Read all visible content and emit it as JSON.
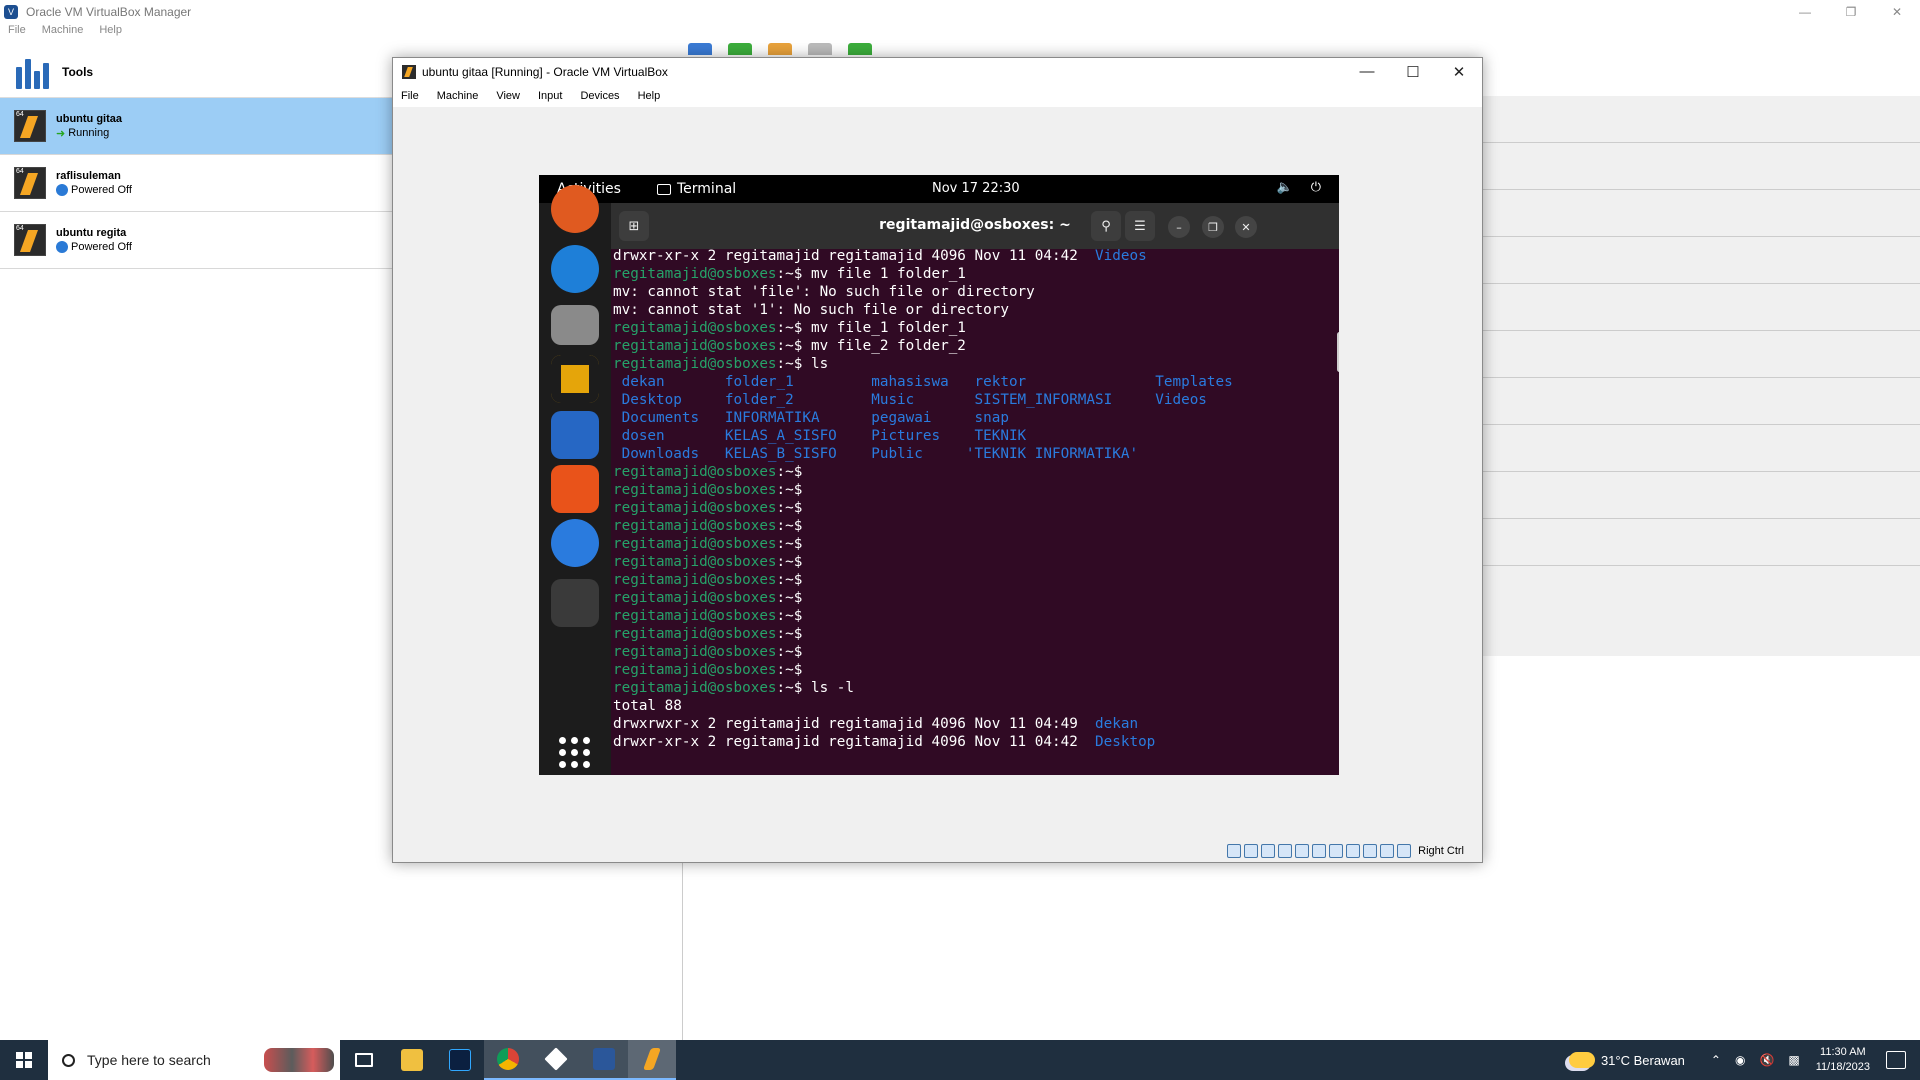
{
  "manager": {
    "title": "Oracle VM VirtualBox Manager",
    "menu": [
      "File",
      "Machine",
      "Help"
    ],
    "tools_label": "Tools",
    "vms": [
      {
        "name": "ubuntu gitaa",
        "state": "Running"
      },
      {
        "name": "raflisuleman",
        "state": "Powered Off"
      },
      {
        "name": "ubuntu regita",
        "state": "Powered Off"
      }
    ]
  },
  "vm_window": {
    "title": "ubuntu gitaa [Running] - Oracle VM VirtualBox",
    "menu": [
      "File",
      "Machine",
      "View",
      "Input",
      "Devices",
      "Help"
    ],
    "host_key": "Right Ctrl"
  },
  "guest": {
    "activities": "Activities",
    "app_name": "Terminal",
    "clock": "Nov 17  22:30",
    "terminal_title": "regitamajid@osboxes: ~"
  },
  "terminal": {
    "prompt": "regitamajid@osboxes",
    "lines": [
      {
        "type": "out",
        "text": "drwxr-xr-x 2 regitamajid regitamajid 4096 Nov 11 04:42  ",
        "dir": "Videos"
      },
      {
        "type": "cmd",
        "text": ":~$ mv file 1 folder_1"
      },
      {
        "type": "out",
        "text": "mv: cannot stat 'file': No such file or directory"
      },
      {
        "type": "out",
        "text": "mv: cannot stat '1': No such file or directory"
      },
      {
        "type": "cmd",
        "text": ":~$ mv file_1 folder_1"
      },
      {
        "type": "cmd",
        "text": ":~$ mv file_2 folder_2"
      },
      {
        "type": "cmd",
        "text": ":~$ ls"
      },
      {
        "type": "dirs",
        "text": " dekan       folder_1         mahasiswa   rektor               Templates"
      },
      {
        "type": "dirs",
        "text": " Desktop     folder_2         Music       SISTEM_INFORMASI     Videos"
      },
      {
        "type": "dirs",
        "text": " Documents   INFORMATIKA      pegawai     snap"
      },
      {
        "type": "dirs",
        "text": " dosen       KELAS_A_SISFO    Pictures    TEKNIK"
      },
      {
        "type": "dirs",
        "text": " Downloads   KELAS_B_SISFO    Public     'TEKNIK INFORMATIKA'"
      },
      {
        "type": "cmd",
        "text": ":~$"
      },
      {
        "type": "cmd",
        "text": ":~$"
      },
      {
        "type": "cmd",
        "text": ":~$"
      },
      {
        "type": "cmd",
        "text": ":~$"
      },
      {
        "type": "cmd",
        "text": ":~$"
      },
      {
        "type": "cmd",
        "text": ":~$"
      },
      {
        "type": "cmd",
        "text": ":~$"
      },
      {
        "type": "cmd",
        "text": ":~$"
      },
      {
        "type": "cmd",
        "text": ":~$"
      },
      {
        "type": "cmd",
        "text": ":~$"
      },
      {
        "type": "cmd",
        "text": ":~$"
      },
      {
        "type": "cmd",
        "text": ":~$"
      },
      {
        "type": "cmd",
        "text": ":~$ ls -l"
      },
      {
        "type": "out",
        "text": "total 88"
      },
      {
        "type": "out",
        "text": "drwxrwxr-x 2 regitamajid regitamajid 4096 Nov 11 04:49  ",
        "dir": "dekan"
      },
      {
        "type": "out",
        "text": "drwxr-xr-x 2 regitamajid regitamajid 4096 Nov 11 04:42  ",
        "dir": "Desktop"
      }
    ]
  },
  "taskbar": {
    "search_placeholder": "Type here to search",
    "weather": "31°C  Berawan",
    "time": "11:30 AM",
    "date": "11/18/2023"
  }
}
